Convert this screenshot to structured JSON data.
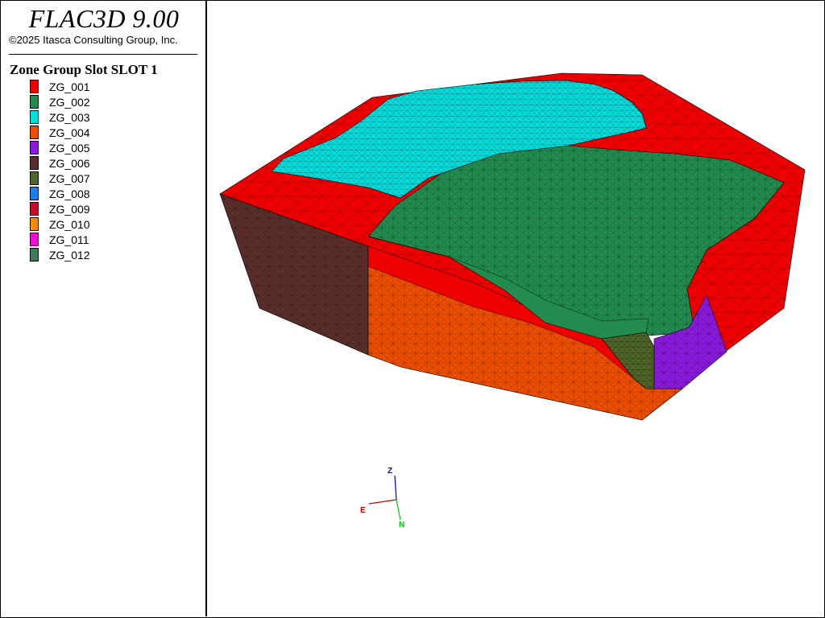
{
  "app": {
    "title": "FLAC3D 9.00",
    "copyright": "©2025 Itasca Consulting Group, Inc."
  },
  "legend": {
    "title": "Zone Group Slot SLOT 1",
    "items": [
      {
        "label": "ZG_001",
        "color": "#ee0000"
      },
      {
        "label": "ZG_002",
        "color": "#228b4e"
      },
      {
        "label": "ZG_003",
        "color": "#00dede"
      },
      {
        "label": "ZG_004",
        "color": "#ee4e00"
      },
      {
        "label": "ZG_005",
        "color": "#8a1adc"
      },
      {
        "label": "ZG_006",
        "color": "#5a2e2a"
      },
      {
        "label": "ZG_007",
        "color": "#4e6628"
      },
      {
        "label": "ZG_008",
        "color": "#1a7cee"
      },
      {
        "label": "ZG_009",
        "color": "#c8082c"
      },
      {
        "label": "ZG_010",
        "color": "#ff8a00"
      },
      {
        "label": "ZG_011",
        "color": "#ee10d0"
      },
      {
        "label": "ZG_012",
        "color": "#3e7a5e"
      }
    ]
  },
  "axes": {
    "z": "Z",
    "e": "E",
    "n": "N"
  }
}
